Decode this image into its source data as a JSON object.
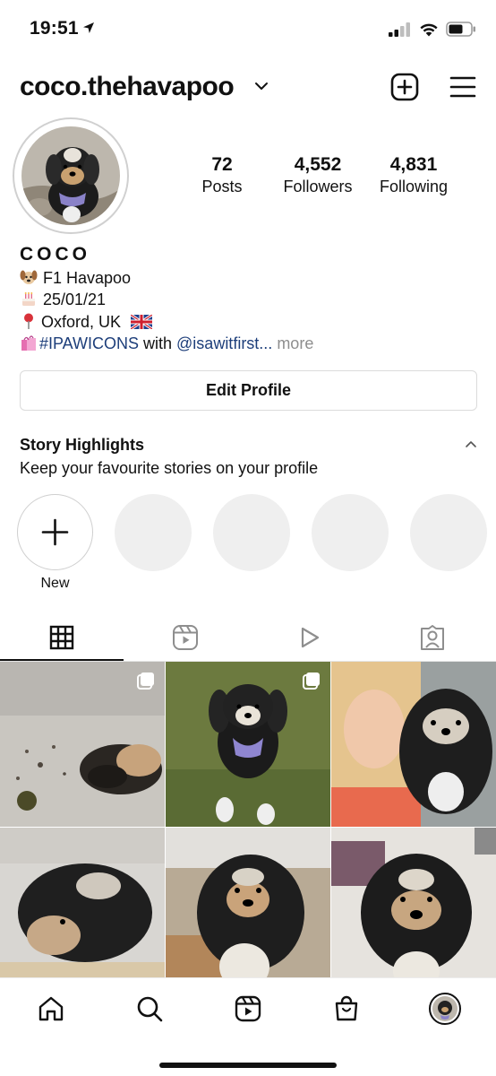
{
  "status_bar": {
    "time": "19:51",
    "icons": [
      "location-arrow-icon",
      "cellular-signal-icon",
      "wifi-icon",
      "battery-icon"
    ]
  },
  "header": {
    "username": "coco.thehavapoo",
    "icons": [
      "chevron-down-icon",
      "new-post-icon",
      "menu-icon"
    ]
  },
  "profile": {
    "stats": [
      {
        "value": "72",
        "label": "Posts"
      },
      {
        "value": "4,552",
        "label": "Followers"
      },
      {
        "value": "4,831",
        "label": "Following"
      }
    ],
    "display_name": "COCO",
    "bio": {
      "line1": "F1 Havapoo",
      "line2": "25/01/21",
      "line3": "Oxford, UK",
      "line4_hashtag": "#IPAWICONS",
      "line4_with": " with ",
      "line4_mention": "@isawitfirst...",
      "line4_more": " more"
    },
    "bio_icons": [
      "dog-face-icon",
      "birthday-cake-icon",
      "round-pushpin-icon",
      "uk-flag-icon",
      "shopping-bags-icon"
    ],
    "edit_profile_label": "Edit Profile"
  },
  "highlights": {
    "title": "Story Highlights",
    "subtitle": "Keep your favourite stories on your profile",
    "new_label": "New"
  },
  "tabs": [
    {
      "name": "grid",
      "icon": "grid-icon",
      "active": true
    },
    {
      "name": "reels",
      "icon": "reels-icon",
      "active": false
    },
    {
      "name": "videos",
      "icon": "play-icon",
      "active": false
    },
    {
      "name": "tagged",
      "icon": "tagged-person-icon",
      "active": false
    }
  ],
  "bottom_nav": [
    "home-icon",
    "search-icon",
    "reels-icon",
    "shop-icon",
    "profile-avatar-icon"
  ],
  "colors": {
    "link": "#1d3e7a",
    "muted": "#8e8e8e",
    "border": "#dbdbdb",
    "placeholder": "#efefef"
  }
}
